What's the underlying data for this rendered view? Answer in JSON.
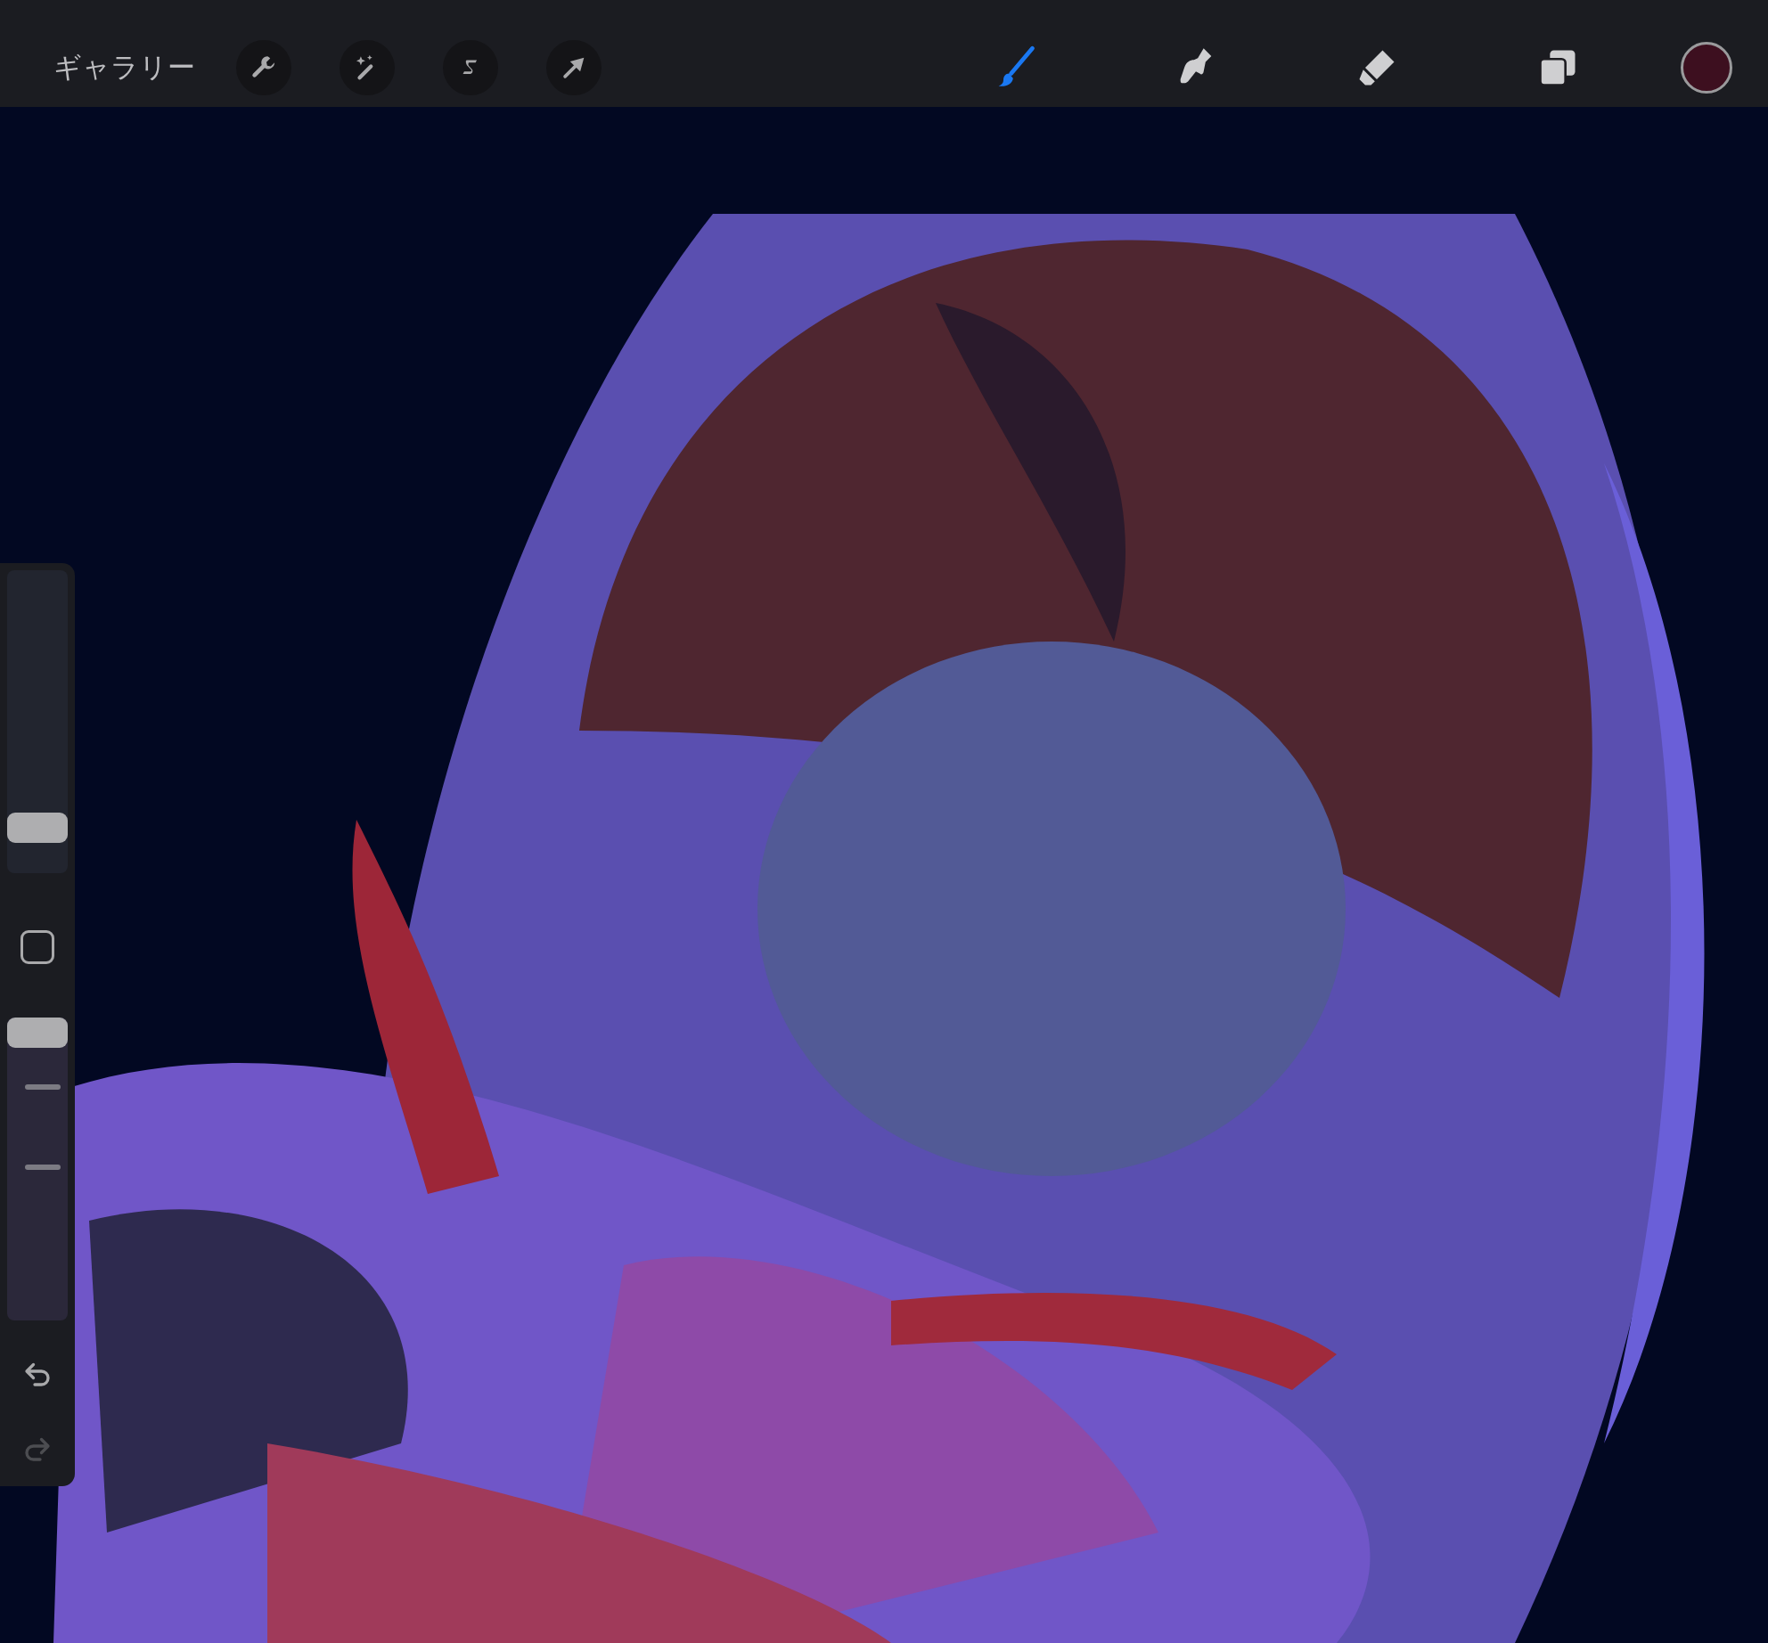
{
  "toolbar": {
    "gallery_label": "ギャラリー",
    "actions": [
      {
        "kind": "wrench"
      },
      {
        "kind": "wand"
      },
      {
        "kind": "selection"
      },
      {
        "kind": "transform"
      }
    ],
    "tools": [
      {
        "kind": "brush",
        "selected": true
      },
      {
        "kind": "smudge",
        "selected": false
      },
      {
        "kind": "eraser",
        "selected": false
      }
    ],
    "layers_button": {
      "kind": "layers"
    },
    "color": "#3d0f1f"
  },
  "sidebar": {
    "brush_size": {
      "level": 0.15
    },
    "opacity": {
      "level": 0.95
    },
    "undo": {
      "disabled": false
    },
    "redo": {
      "disabled": true
    }
  }
}
